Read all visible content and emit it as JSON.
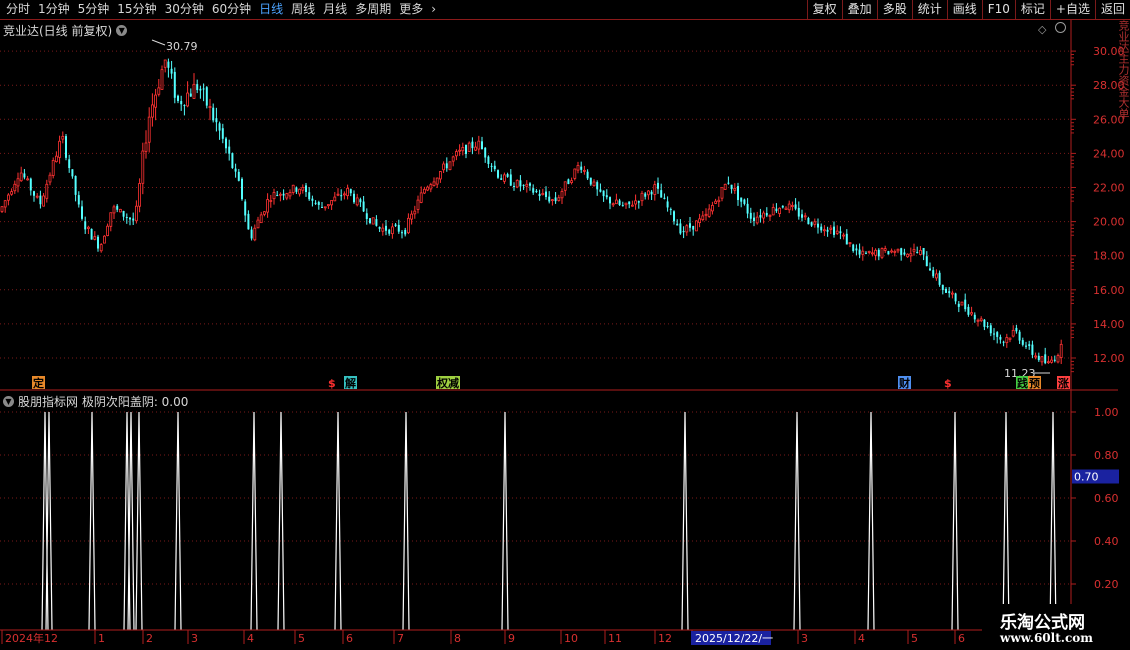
{
  "toolbar": {
    "periods": [
      {
        "label": "分时",
        "active": false
      },
      {
        "label": "1分钟",
        "active": false
      },
      {
        "label": "5分钟",
        "active": false
      },
      {
        "label": "15分钟",
        "active": false
      },
      {
        "label": "30分钟",
        "active": false
      },
      {
        "label": "60分钟",
        "active": false
      },
      {
        "label": "日线",
        "active": true
      },
      {
        "label": "周线",
        "active": false
      },
      {
        "label": "月线",
        "active": false
      },
      {
        "label": "多周期",
        "active": false
      },
      {
        "label": "更多",
        "active": false
      }
    ],
    "more_arrow": "›",
    "tools": [
      "复权",
      "叠加",
      "多股",
      "统计",
      "画线",
      "F10",
      "标记",
      "+自选",
      "返回"
    ]
  },
  "main_chart": {
    "title": "竞业达(日线 前复权)",
    "y_ticks": [
      "30.00",
      "28.00",
      "26.00",
      "24.00",
      "22.00",
      "20.00",
      "18.00",
      "16.00",
      "14.00",
      "12.00"
    ],
    "high_label": "30.79",
    "low_label": "11.23",
    "markers": [
      {
        "text": "定",
        "color": "#e8892a"
      },
      {
        "text": "$",
        "color": "#ff3030"
      },
      {
        "text": "解",
        "color": "#36c2c2"
      },
      {
        "text": "权减",
        "color": "#9fd040"
      },
      {
        "text": "财",
        "color": "#4f8ff0"
      },
      {
        "text": "$",
        "color": "#ff3030"
      },
      {
        "text": "践",
        "color": "#44cc44"
      },
      {
        "text": "预",
        "color": "#e8892a"
      },
      {
        "text": "涨",
        "color": "#ff4040"
      }
    ]
  },
  "indicator": {
    "title": "股朋指标网  极阴次阳盖阴: 0.00",
    "y_ticks": [
      "1.00",
      "0.80",
      "0.60",
      "0.40",
      "0.20"
    ],
    "current_value": "0.70",
    "spike_count": 22
  },
  "x_axis": {
    "labels": [
      "2024年12",
      "1",
      "2",
      "3",
      "4",
      "5",
      "6",
      "7",
      "8",
      "9",
      "10",
      "11",
      "12",
      "2025/12/22/一",
      "3",
      "4",
      "5",
      "6"
    ],
    "highlight": "2025/12/22/一"
  },
  "right_strip_text": "竞业达主力资金大单",
  "logo": {
    "name": "乐淘公式网",
    "url": "www.60lt.com"
  },
  "colors": {
    "up": "#ff3232",
    "down": "#54ffff",
    "grid": "#7a1a1a",
    "axis": "#b01e1e",
    "spike": "#ffffff"
  }
}
